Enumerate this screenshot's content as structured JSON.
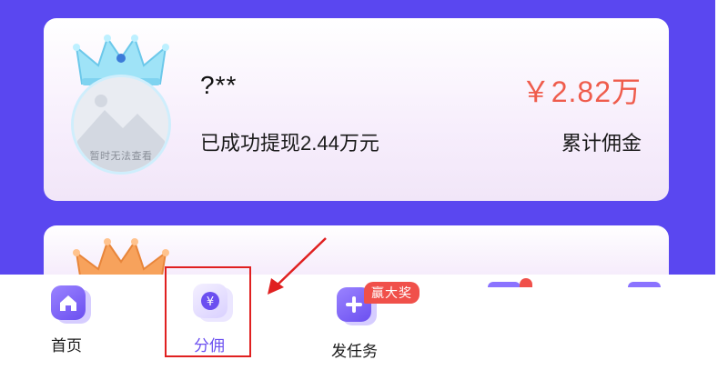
{
  "card1": {
    "username": "?**",
    "amount": "￥2.82万",
    "withdrawn_text": "已成功提现2.44万元",
    "amount_label": "累计佣金",
    "avatar_caption": "暂时无法查看"
  },
  "bottom_nav": {
    "items": [
      {
        "label": "首页",
        "icon": "home-icon"
      },
      {
        "label": "分佣",
        "icon": "yen-icon",
        "active": true
      },
      {
        "label": "发任务",
        "icon": "plus-icon",
        "badge": "赢大奖"
      }
    ]
  },
  "colors": {
    "background": "#5a47f0",
    "accent": "#6b4ff0",
    "amount": "#ef5c4c",
    "highlight": "#e02020"
  }
}
